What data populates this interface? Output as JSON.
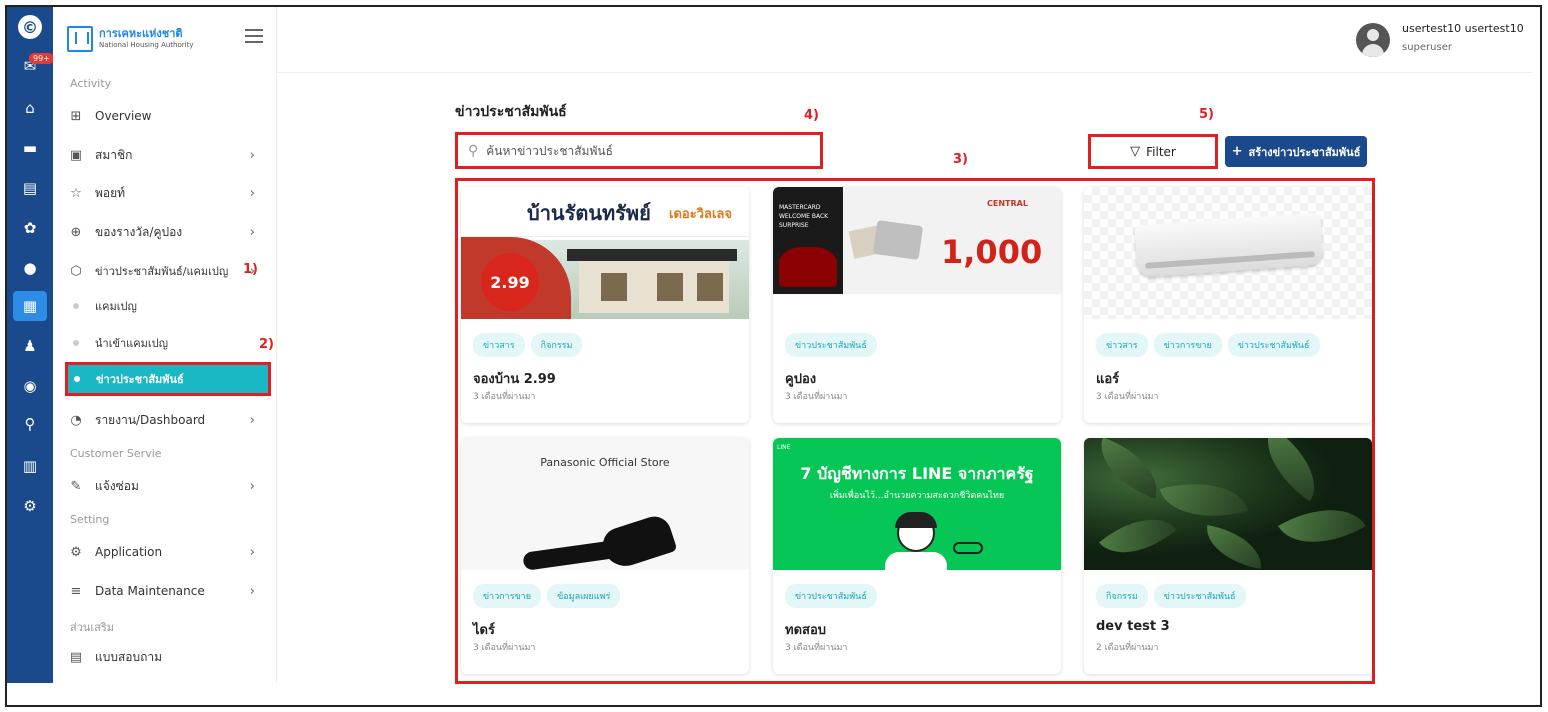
{
  "app": {
    "brand_th": "การเคหะแห่งชาติ",
    "brand_en": "National Housing Authority",
    "badge": "99+",
    "colors": {
      "primary": "#1b4a8c",
      "accent": "#1ab8c4",
      "annotation": "#e02020"
    }
  },
  "rail": {
    "icons": [
      "logo-icon",
      "mail-icon",
      "home-icon",
      "cards-icon",
      "document-icon",
      "gear-icon",
      "user-icon",
      "dashboard-icon",
      "group-icon",
      "settings-icon",
      "search-icon",
      "chart-icon",
      "cogs-icon"
    ]
  },
  "sidebar": {
    "sections": {
      "activity": "Activity",
      "customer": "Customer Servie",
      "setting": "Setting",
      "extra": "ส่วนเสริม"
    },
    "items": [
      {
        "label": "Overview",
        "icon": "overview-icon"
      },
      {
        "label": "สมาชิก",
        "icon": "member-icon"
      },
      {
        "label": "พอยท์",
        "icon": "star-icon"
      },
      {
        "label": "ของรางวัล/คูปอง",
        "icon": "gift-icon"
      },
      {
        "label": "ข่าวประชาสัมพันธ์/แคมเปญ",
        "icon": "cube-icon"
      },
      {
        "label": "แคมเปญ",
        "icon": "dot-icon"
      },
      {
        "label": "นำเข้าแคมเปญ",
        "icon": "dot-icon"
      },
      {
        "label": "ข่าวประชาสัมพันธ์",
        "icon": "dot-icon"
      },
      {
        "label": "รายงาน/Dashboard",
        "icon": "report-icon"
      },
      {
        "label": "แจ้งซ่อม",
        "icon": "wrench-icon"
      },
      {
        "label": "Application",
        "icon": "gear-icon"
      },
      {
        "label": "Data Maintenance",
        "icon": "sliders-icon"
      },
      {
        "label": "แบบสอบถาม",
        "icon": "survey-icon"
      }
    ]
  },
  "annotations": {
    "a1": "1)",
    "a2": "2)",
    "a3": "3)",
    "a4": "4)",
    "a5": "5)"
  },
  "header": {
    "user_name": "usertest10 usertest10",
    "user_role": "superuser"
  },
  "main": {
    "title": "ข่าวประชาสัมพันธ์",
    "search_placeholder": "ค้นหาข่าวประชาสัมพันธ์",
    "filter_label": "Filter",
    "create_label": "สร้างข่าวประชาสัมพันธ์"
  },
  "cards": [
    {
      "title": "จองบ้าน 2.99",
      "time": "3 เดือนที่ผ่านมา",
      "tags": [
        "ข่าวสาร",
        "กิจกรรม"
      ],
      "image_text": {
        "headline": "บ้านรัตนทรัพย์",
        "sub": "เดอะวิลเลจ",
        "price": "2.99"
      }
    },
    {
      "title": "คูปอง",
      "time": "3 เดือนที่ผ่านมา",
      "tags": [
        "ข่าวประชาสัมพันธ์"
      ],
      "image_text": {
        "left": "MASTERCARD WELCOME BACK SURPRISE",
        "brand": "CENTRAL",
        "amount": "1,000"
      }
    },
    {
      "title": "แอร์",
      "time": "3 เดือนที่ผ่านมา",
      "tags": [
        "ข่าวสาร",
        "ข่าวการขาย",
        "ข่าวประชาสัมพันธ์"
      ],
      "image_text": {}
    },
    {
      "title": "ไดร์",
      "time": "3 เดือนที่ผ่านมา",
      "tags": [
        "ข่าวการขาย",
        "ข้อมูลเผยแพร่"
      ],
      "image_text": {
        "store": "Panasonic Official Store"
      }
    },
    {
      "title": "ทดสอบ",
      "time": "3 เดือนที่ผ่านมา",
      "tags": [
        "ข่าวประชาสัมพันธ์"
      ],
      "image_text": {
        "small": "LINE",
        "headline": "7 บัญชีทางการ LINE จากภาครัฐ",
        "sub": "เพิ่มเพื่อนไว้...อำนวยความสะดวกชีวิตคนไทย"
      }
    },
    {
      "title": "dev test 3",
      "time": "2 เดือนที่ผ่านมา",
      "tags": [
        "กิจกรรม",
        "ข่าวประชาสัมพันธ์"
      ],
      "image_text": {}
    }
  ]
}
